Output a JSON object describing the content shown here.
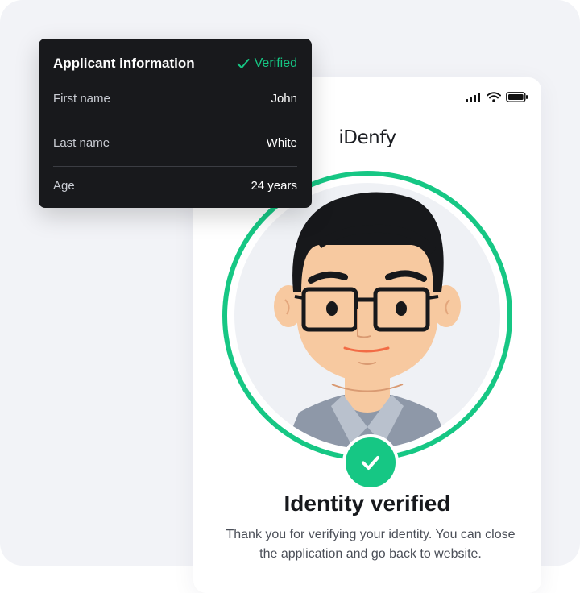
{
  "applicant_card": {
    "title": "Applicant information",
    "status": "Verified",
    "rows": [
      {
        "label": "First name",
        "value": "John"
      },
      {
        "label": "Last name",
        "value": "White"
      },
      {
        "label": "Age",
        "value": "24 years"
      }
    ]
  },
  "phone": {
    "logo": "iDenfy",
    "title": "Identity verified",
    "description": "Thank you for verifying your identity. You can close the application and go back to website."
  },
  "colors": {
    "accent_green": "#16c784",
    "card_dark": "#18191c",
    "background": "#f2f3f7"
  },
  "icons": [
    "signal-icon",
    "wifi-icon",
    "battery-icon",
    "check-icon",
    "avatar-illustration"
  ]
}
